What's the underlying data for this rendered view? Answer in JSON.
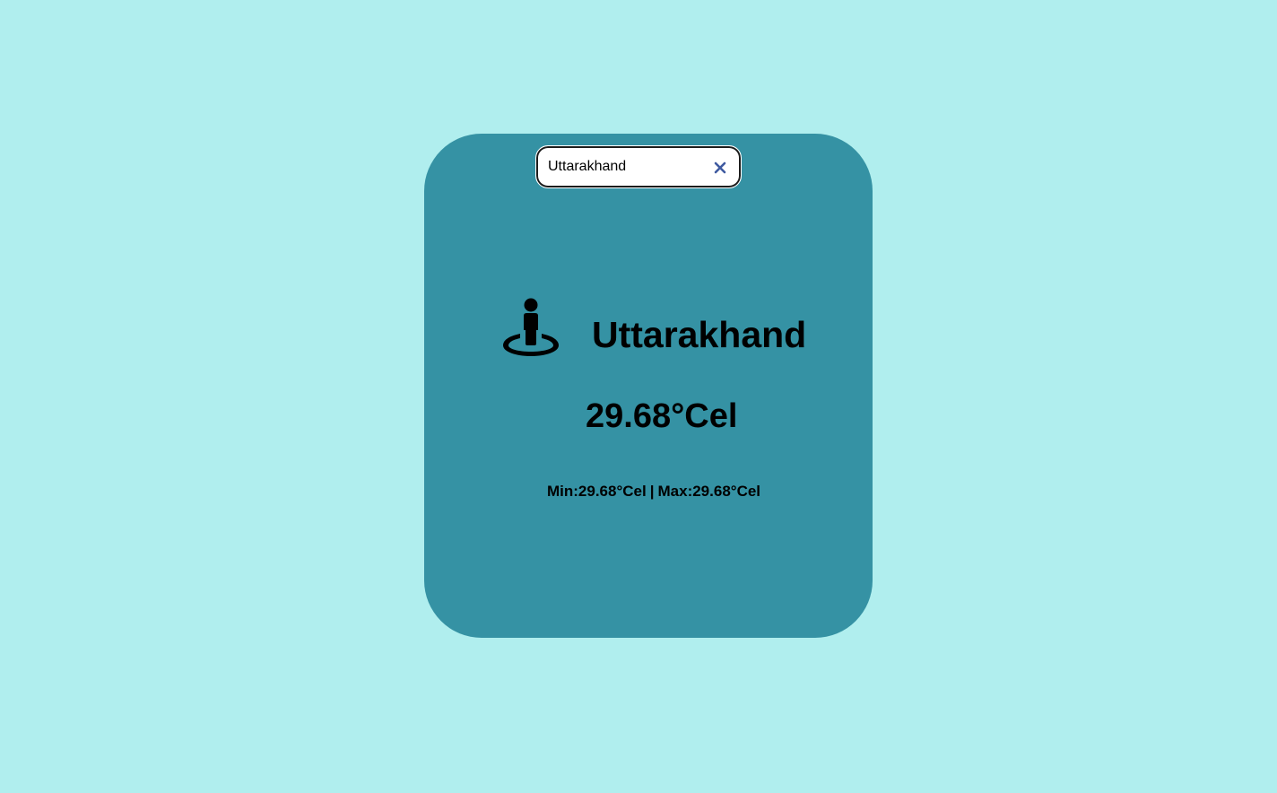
{
  "search": {
    "value": "Uttarakhand",
    "clear_icon": "close-icon"
  },
  "weather": {
    "location_icon": "street-view-icon",
    "city": "Uttarakhand",
    "temperature": "29.68°Cel",
    "min_label": "Min:29.68°Cel",
    "separator": "|",
    "max_label": "Max:29.68°Cel"
  },
  "colors": {
    "page_background": "#b0eeee",
    "card_background": "#3592a4",
    "clear_icon": "#3f5aa0"
  }
}
